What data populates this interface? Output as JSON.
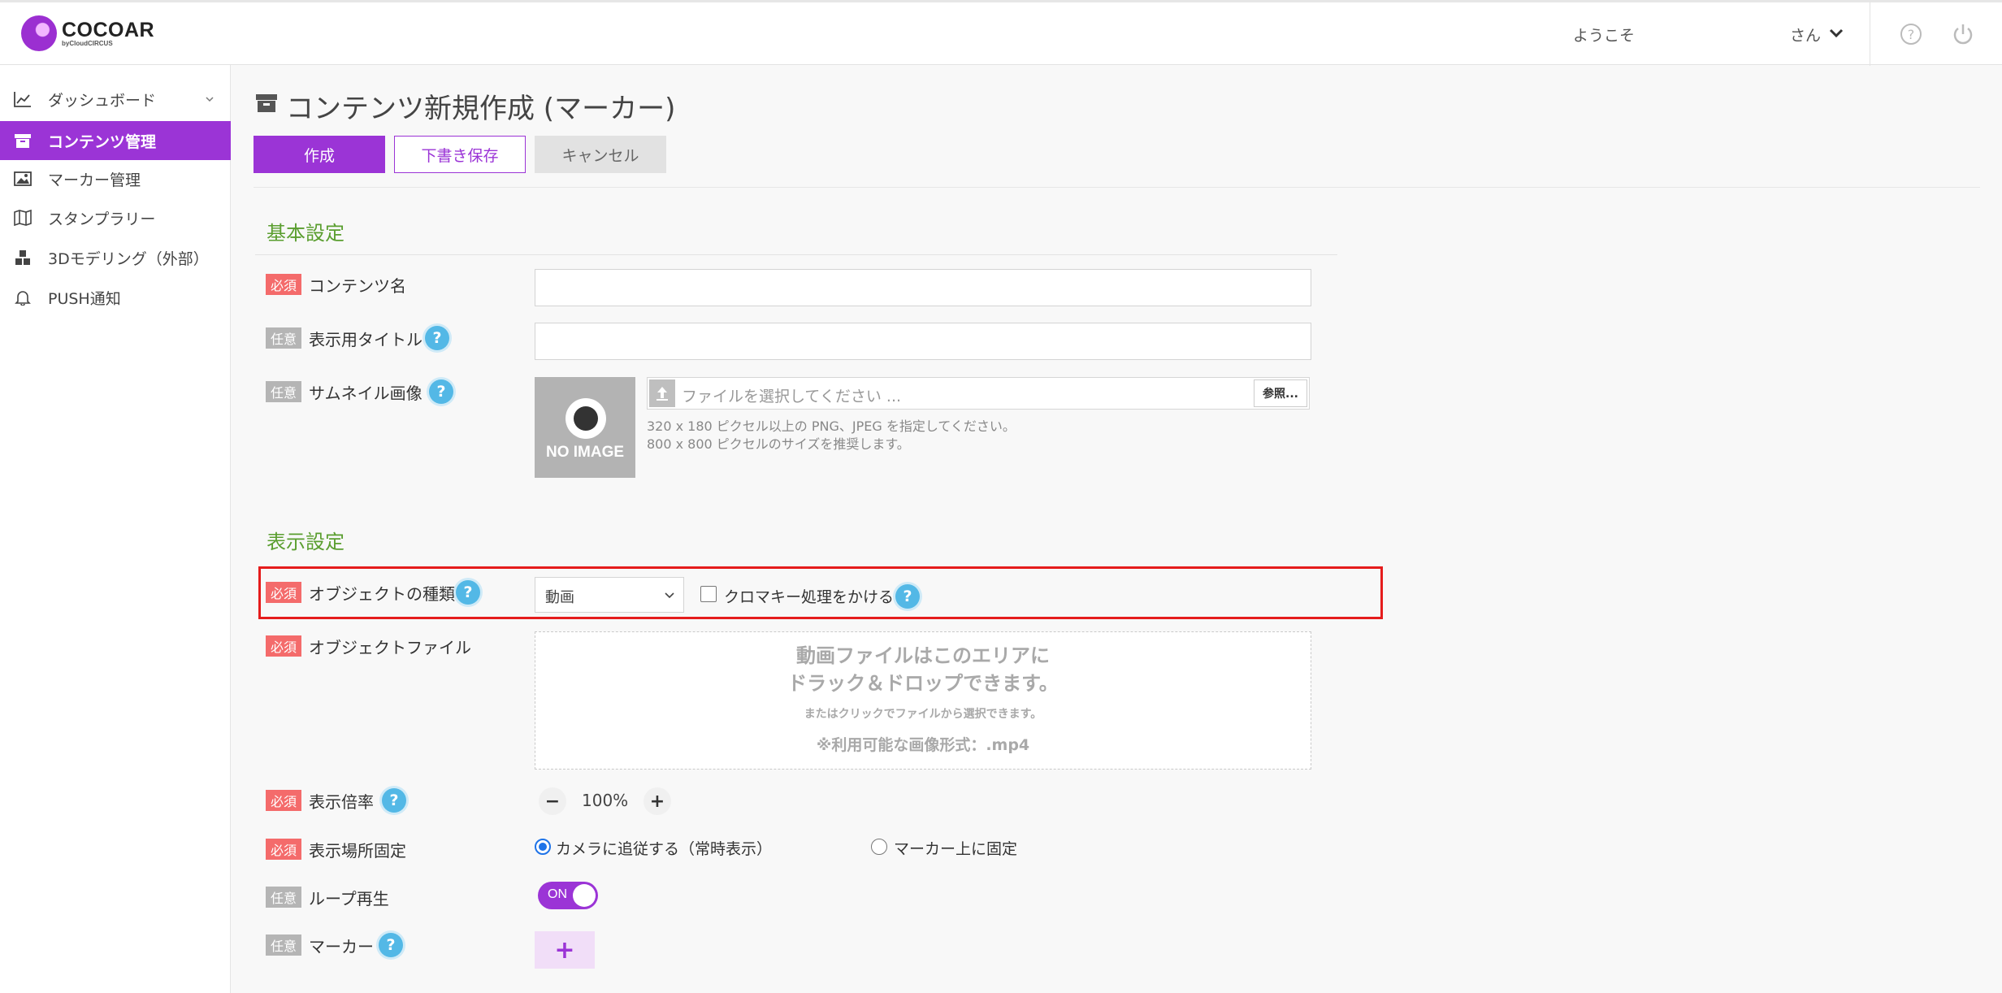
{
  "header": {
    "logo_text": "COCOAR",
    "logo_sub": "byCloudCIRCUS",
    "welcome": "ようこそ",
    "user_suffix": "さん"
  },
  "sidebar": {
    "items": [
      {
        "label": "ダッシュボード",
        "icon": "chart-line-icon"
      },
      {
        "label": "コンテンツ管理",
        "icon": "archive-box-icon"
      },
      {
        "label": "マーカー管理",
        "icon": "image-icon"
      },
      {
        "label": "スタンプラリー",
        "icon": "map-icon"
      },
      {
        "label": "3Dモデリング（外部）",
        "icon": "cubes-icon"
      },
      {
        "label": "PUSH通知",
        "icon": "bell-icon"
      }
    ]
  },
  "page": {
    "title": "コンテンツ新規作成 (マーカー)",
    "buttons": {
      "create": "作成",
      "draft": "下書き保存",
      "cancel": "キャンセル"
    }
  },
  "basic": {
    "section_title": "基本設定",
    "required_badge": "必須",
    "optional_badge": "任意",
    "content_name_label": "コンテンツ名",
    "display_title_label": "表示用タイトル",
    "thumbnail_label": "サムネイル画像",
    "no_image": "NO IMAGE",
    "file_placeholder": "ファイルを選択してください ...",
    "browse": "参照...",
    "hint1": "320 x 180 ピクセル以上の PNG、JPEG を指定してください。",
    "hint2": "800 x 800 ピクセルのサイズを推奨します。"
  },
  "display": {
    "section_title": "表示設定",
    "object_type_label": "オブジェクトの種類",
    "object_type_value": "動画",
    "chroma_label": "クロマキー処理をかける",
    "object_file_label": "オブジェクトファイル",
    "dz_line1": "動画ファイルはこのエリアに",
    "dz_line2": "ドラック＆ドロップできます。",
    "dz_line3": "またはクリックでファイルから選択できます。",
    "dz_line4": "※利用可能な画像形式：.mp4",
    "scale_label": "表示倍率",
    "scale_value": "100%",
    "position_label": "表示場所固定",
    "position_opt1": "カメラに追従する（常時表示）",
    "position_opt2": "マーカー上に固定",
    "loop_label": "ループ再生",
    "loop_toggle": "ON",
    "marker_label": "マーカー",
    "qmark": "?",
    "minus": "−",
    "plus": "+"
  },
  "colors": {
    "accent": "#9b34d6",
    "section": "#5a9e2f",
    "required": "#f46b6b",
    "optional": "#b5b5b5",
    "help": "#53b8e6",
    "highlight": "#e51c1c"
  }
}
